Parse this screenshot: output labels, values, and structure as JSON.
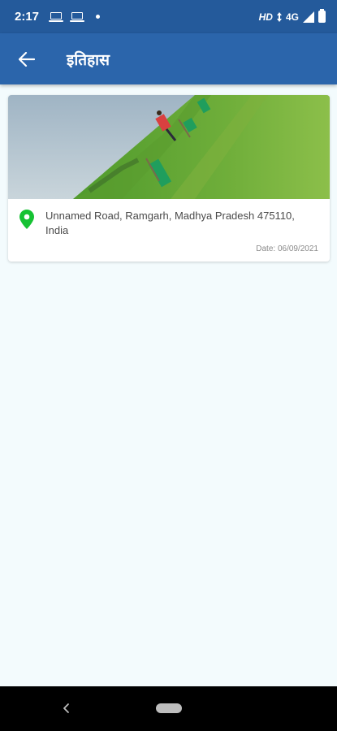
{
  "status_bar": {
    "time": "2:17",
    "network_label": "HD",
    "network_type": "4G",
    "icons": [
      "laptop-icon",
      "laptop-icon",
      "notification-dot",
      "signal-icon",
      "battery-icon"
    ]
  },
  "app_bar": {
    "title": "इतिहास",
    "back_icon": "arrow-left-icon"
  },
  "history": [
    {
      "address": "Unnamed Road, Ramgarh, Madhya Pradesh 475110, India",
      "date": "Date: 06/09/2021",
      "icon": "location-pin-icon"
    }
  ],
  "colors": {
    "status_bar": "#245a9b",
    "app_bar": "#2b65ab",
    "background": "#f3fbfd",
    "pin": "#16c233"
  },
  "nav_bar": {
    "icons": [
      "back-chevron-icon",
      "home-pill-icon"
    ]
  }
}
